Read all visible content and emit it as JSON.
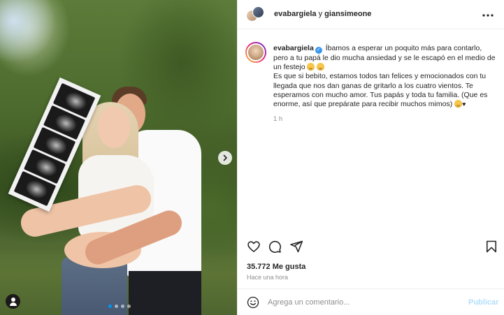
{
  "header": {
    "user1": "evabargiela",
    "connector": " y ",
    "user2": "giansimeone",
    "more_icon": "more-horizontal-icon"
  },
  "caption": {
    "username": "evabargiela",
    "line1": " Íbamos a esperar un poquito más para contarlo, pero a tu papá le dio mucha ansiedad y se le escapó en el medio de un festejo ",
    "line2": "Es que si bebito, estamos todos tan felices y emocionados con tu llegada que nos dan ganas de gritarlo a los cuatro vientos. Te esperamos con mucho amor. Tus papás y toda tu familia. (Que es enorme, así que prepárate para recibir muchos mimos) ",
    "heart": "♥",
    "time": "1 h"
  },
  "post": {
    "likes_count": "35.772",
    "likes_label": "Me gusta",
    "posted_ago": "Hace una hora"
  },
  "comment": {
    "placeholder": "Agrega un comentario...",
    "publish_label": "Publicar"
  },
  "carousel": {
    "total_slides": 4,
    "active_slide": 1,
    "next_icon": "chevron-right-icon"
  },
  "colors": {
    "accent_blue": "#0095f6",
    "verified_blue": "#3897f0",
    "muted_text": "#8e8e8e",
    "publish_disabled": "#b2dffc"
  }
}
